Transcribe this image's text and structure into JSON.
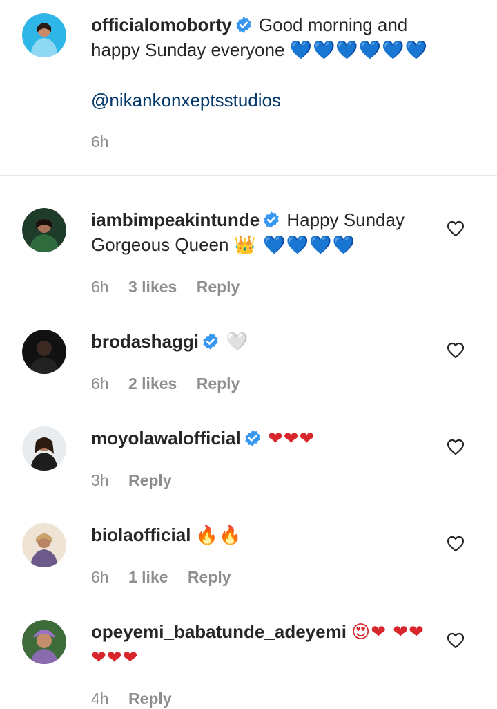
{
  "caption": {
    "username": "officialomoborty",
    "text": "Good morning and happy Sunday everyone",
    "emojis": "💙💙💙💙💙💙",
    "mention": "@nikankonxeptsstudios",
    "time": "6h"
  },
  "comments": [
    {
      "username": "iambimpeakintunde",
      "verified": true,
      "text": "Happy Sunday Gorgeous Queen",
      "emojis": "👑 💙💙💙💙",
      "time": "6h",
      "likes": "3 likes",
      "reply": "Reply"
    },
    {
      "username": "brodashaggi",
      "verified": true,
      "text": "",
      "emojis": "🤍",
      "time": "6h",
      "likes": "2 likes",
      "reply": "Reply"
    },
    {
      "username": "moyolawalofficial",
      "verified": true,
      "text": "",
      "emojis": "❤❤❤",
      "time": "3h",
      "likes": "",
      "reply": "Reply"
    },
    {
      "username": "biolaofficial",
      "verified": false,
      "text": "",
      "emojis": "🔥🔥",
      "time": "6h",
      "likes": "1 like",
      "reply": "Reply"
    },
    {
      "username": "opeyemi_babatunde_adeyemi",
      "verified": false,
      "text": "",
      "emojis": "😍❤ ❤❤❤❤❤",
      "time": "4h",
      "likes": "",
      "reply": "Reply"
    }
  ],
  "colors": {
    "verified_badge": "#3897f0",
    "mention": "#00376b",
    "meta_text": "#8e8e8e",
    "divider": "#e6e6e6"
  },
  "icons": {
    "verified": "verified-badge-icon",
    "like": "heart-outline-icon"
  }
}
